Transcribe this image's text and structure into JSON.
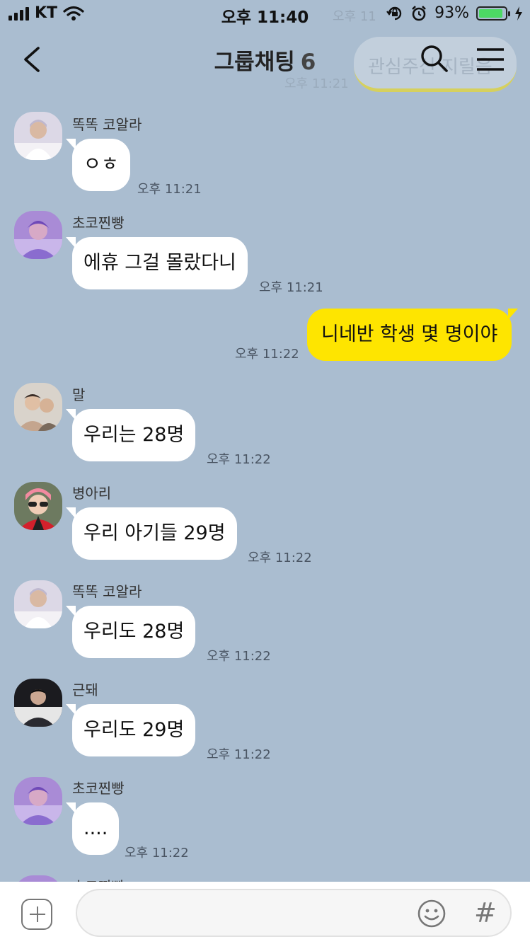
{
  "status_bar": {
    "carrier": "KT",
    "time": "오후 11:40",
    "battery": "93%",
    "battery_level": 0.93
  },
  "ghost": {
    "time_top": "오후 11",
    "time": "오후 11:21",
    "text": "관심주신 지릴음"
  },
  "header": {
    "title": "그룹채팅",
    "member_count": "6"
  },
  "messages": [
    {
      "sender": "똑똑 코알라",
      "text": "ㅇㅎ",
      "time": "오후 11:21"
    },
    {
      "sender": "초코찐빵",
      "text": "에휴 그걸 몰랐다니",
      "time": "오후 11:21"
    },
    {
      "text": "니네반 학생 몇 명이야",
      "time": "오후 11:22"
    },
    {
      "sender": "말",
      "text": "우리는 28명",
      "time": "오후 11:22"
    },
    {
      "sender": "병아리",
      "text": "우리 아기들 29명",
      "time": "오후 11:22"
    },
    {
      "sender": "똑똑 코알라",
      "text": "우리도 28명",
      "time": "오후 11:22"
    },
    {
      "sender": "근돼",
      "text": "우리도 29명",
      "time": "오후 11:22"
    },
    {
      "sender": "초코찐빵",
      "text": "....",
      "time": "오후 11:22"
    },
    {
      "sender": "초코찐빵"
    }
  ],
  "input": {
    "placeholder": "",
    "hash_symbol": "#"
  },
  "colors": {
    "background": "#aabdd0",
    "my_bubble": "#fee500",
    "other_bubble": "#ffffff",
    "battery": "#4cd964"
  }
}
